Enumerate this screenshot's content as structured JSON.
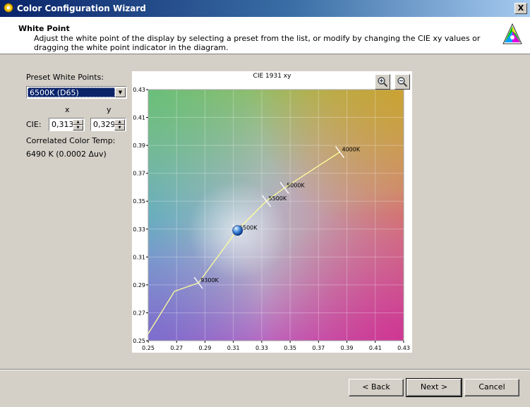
{
  "window": {
    "title": "Color Configuration Wizard",
    "close_glyph": "X"
  },
  "header": {
    "title": "White Point",
    "description": "Adjust the white point of the display by selecting a preset from the list, or modify by changing the CIE xy values or dragging the white point indicator in the diagram."
  },
  "presets": {
    "label": "Preset White Points:",
    "selected": "6500K (D65)"
  },
  "cie": {
    "label": "CIE:",
    "x_header": "x",
    "y_header": "y",
    "x_value": "0,313",
    "y_value": "0,329"
  },
  "cct": {
    "label": "Correlated Color Temp:",
    "value": "6490 K (0.0002 Δuv)"
  },
  "buttons": {
    "back": "< Back",
    "next": "Next >",
    "cancel": "Cancel"
  },
  "chart_data": {
    "type": "line",
    "title": "CIE 1931 xy",
    "xlim": [
      0.25,
      0.43
    ],
    "ylim": [
      0.25,
      0.43
    ],
    "x_ticks": [
      "0.25",
      "0.27",
      "0.29",
      "0.31",
      "0.33",
      "0.35",
      "0.37",
      "0.39",
      "0.41",
      "0.43"
    ],
    "y_ticks": [
      "0.25",
      "0.27",
      "0.29",
      "0.31",
      "0.33",
      "0.35",
      "0.37",
      "0.39",
      "0.41",
      "0.43"
    ],
    "grid": true,
    "series": [
      {
        "x": [
          0.25,
          0.2685,
          0.2854,
          0.3126,
          0.3333,
          0.346,
          0.385
        ],
        "y": [
          0.255,
          0.2854,
          0.2914,
          0.3291,
          0.3501,
          0.3595,
          0.3852
        ],
        "color": "#ffff99"
      }
    ],
    "markers": [
      {
        "label": "9300K",
        "x": 0.2854,
        "y": 0.2914
      },
      {
        "label": "6500K",
        "x": 0.3126,
        "y": 0.3291
      },
      {
        "label": "5500K",
        "x": 0.3333,
        "y": 0.3501
      },
      {
        "label": "5000K",
        "x": 0.346,
        "y": 0.3595
      },
      {
        "label": "4000K",
        "x": 0.385,
        "y": 0.3852
      }
    ],
    "white_point": {
      "x": 0.313,
      "y": 0.329
    }
  }
}
